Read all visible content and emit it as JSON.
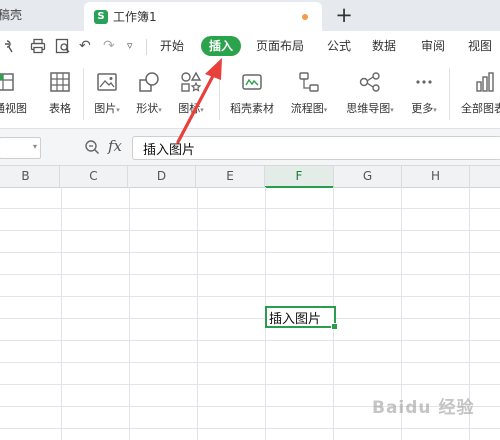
{
  "tabs": {
    "previous_tab_label": "稿壳",
    "active_tab_icon_letter": "S",
    "active_tab_label": "工作簿1",
    "active_tab_unsaved_color": "#f39c4a",
    "new_tab_symbol": "+"
  },
  "quick_access": {
    "icons": [
      "print-preview-icon",
      "print-icon",
      "preview-icon",
      "undo-icon",
      "redo-icon",
      "more-dropdown-icon"
    ],
    "undo_symbol": "↶",
    "redo_symbol": "↷",
    "more_symbol": "▿"
  },
  "menu": {
    "items": [
      "开始",
      "插入",
      "页面布局",
      "公式",
      "数据",
      "审阅",
      "视图"
    ],
    "active_item": "插入",
    "accent_color": "#2ba24c"
  },
  "ribbon": {
    "buttons": [
      {
        "label": "普通视图",
        "icon": "normal-view-icon"
      },
      {
        "label": "表格",
        "icon": "table-icon"
      },
      {
        "label": "图片",
        "icon": "picture-icon",
        "dropdown": true
      },
      {
        "label": "形状",
        "icon": "shape-icon",
        "dropdown": true
      },
      {
        "label": "图标",
        "icon": "icon-library-icon",
        "dropdown": true
      },
      {
        "label": "稻壳素材",
        "icon": "docer-material-icon"
      },
      {
        "label": "流程图",
        "icon": "flowchart-icon",
        "dropdown": true
      },
      {
        "label": "思维导图",
        "icon": "mind-map-icon",
        "dropdown": true
      },
      {
        "label": "更多",
        "icon": "more-icon",
        "dropdown": true
      },
      {
        "label": "全部图表",
        "icon": "all-charts-icon"
      }
    ],
    "caret_symbol": "▾"
  },
  "formula_bar": {
    "namebox_value": "",
    "fx_label": "fx",
    "content": "插入图片"
  },
  "grid": {
    "columns": [
      "B",
      "C",
      "D",
      "E",
      "F",
      "G",
      "H"
    ],
    "selected_column": "F",
    "selected_cell_value": "插入图片",
    "selection_color": "#2a9d4e"
  },
  "annotation": {
    "arrow_color": "#e8403a",
    "points_to": "插入"
  },
  "watermark": {
    "text": "Baidu 经验"
  }
}
